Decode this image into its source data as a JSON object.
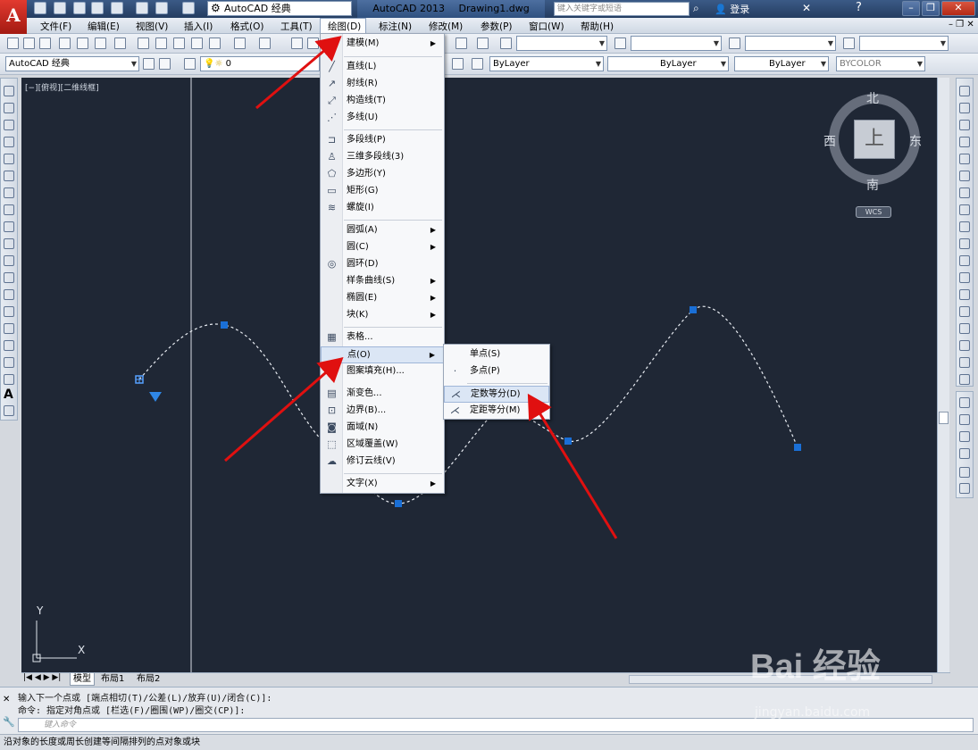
{
  "title_bar": {
    "app_logo": "A",
    "workspace": "AutoCAD 经典",
    "app_name": "AutoCAD 2013",
    "file_name": "Drawing1.dwg",
    "search_placeholder": "键入关键字或短语",
    "login": "登录"
  },
  "menu_bar": {
    "items": [
      "文件(F)",
      "编辑(E)",
      "视图(V)",
      "插入(I)",
      "格式(O)",
      "工具(T)",
      "绘图(D)",
      "标注(N)",
      "修改(M)",
      "参数(P)",
      "窗口(W)",
      "帮助(H)"
    ],
    "active": "绘图(D)"
  },
  "toolbar2": {
    "workspace": "AutoCAD 经典",
    "layer": "0",
    "color": "ByLayer",
    "linetype": "ByLayer",
    "lineweight": "ByLayer",
    "plotstyle": "BYCOLOR"
  },
  "viewport_label": "[−][俯视][二维线框]",
  "draw_menu": {
    "items": [
      {
        "label": "建模(M)",
        "submenu": true,
        "icon": ""
      },
      {
        "label": "直线(L)",
        "icon": "line-icon"
      },
      {
        "label": "射线(R)",
        "icon": "ray-icon"
      },
      {
        "label": "构造线(T)",
        "icon": "xline-icon"
      },
      {
        "label": "多线(U)",
        "icon": "mline-icon"
      },
      {
        "label": "多段线(P)",
        "icon": "polyline-icon"
      },
      {
        "label": "三维多段线(3)",
        "icon": "3dpoly-icon"
      },
      {
        "label": "多边形(Y)",
        "icon": "polygon-icon"
      },
      {
        "label": "矩形(G)",
        "icon": "rectangle-icon"
      },
      {
        "label": "螺旋(I)",
        "icon": "helix-icon"
      },
      {
        "label": "圆弧(A)",
        "submenu": true
      },
      {
        "label": "圆(C)",
        "submenu": true
      },
      {
        "label": "圆环(D)",
        "icon": "donut-icon"
      },
      {
        "label": "样条曲线(S)",
        "submenu": true
      },
      {
        "label": "椭圆(E)",
        "submenu": true
      },
      {
        "label": "块(K)",
        "submenu": true
      },
      {
        "label": "表格...",
        "icon": "table-icon"
      },
      {
        "label": "点(O)",
        "submenu": true,
        "highlighted": true
      },
      {
        "label": "图案填充(H)...",
        "icon": "hatch-icon"
      },
      {
        "label": "渐变色...",
        "icon": "gradient-icon"
      },
      {
        "label": "边界(B)...",
        "icon": "boundary-icon"
      },
      {
        "label": "面域(N)",
        "icon": "region-icon"
      },
      {
        "label": "区域覆盖(W)",
        "icon": "wipeout-icon"
      },
      {
        "label": "修订云线(V)",
        "icon": "revcloud-icon"
      },
      {
        "label": "文字(X)",
        "submenu": true
      }
    ]
  },
  "point_submenu": {
    "items": [
      {
        "label": "单点(S)"
      },
      {
        "label": "多点(P)"
      },
      {
        "label": "定数等分(D)",
        "highlighted": true
      },
      {
        "label": "定距等分(M)"
      }
    ]
  },
  "compass": {
    "north": "北",
    "south": "南",
    "east": "东",
    "west": "西",
    "center": "上",
    "wcs": "WCS"
  },
  "ucs": {
    "x": "X",
    "y": "Y"
  },
  "layout_tabs": [
    "模型",
    "布局1",
    "布局2"
  ],
  "command": {
    "line1": "输入下一个点或 [端点相切(T)/公差(L)/放弃(U)/闭合(C)]:",
    "line2": "命令: 指定对角点或 [栏选(F)/圈围(WP)/圈交(CP)]:",
    "input_placeholder": "键入命令"
  },
  "status_text": "沿对象的长度或周长创建等间隔排列的点对象或块",
  "watermark": {
    "main": "Bai 经验",
    "sub": "jingyan.baidu.com"
  },
  "colors": {
    "canvas": "#1f2735",
    "grip": "#1a6fd6",
    "arrow": "#e01010"
  }
}
